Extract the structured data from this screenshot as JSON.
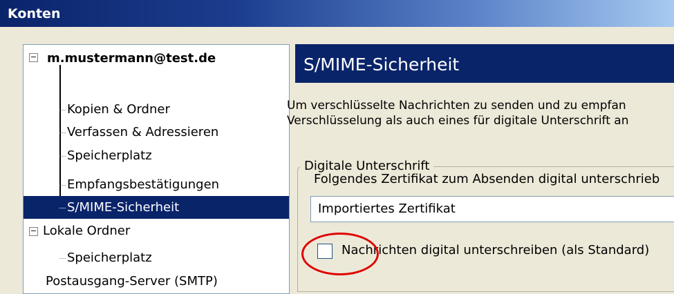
{
  "window": {
    "title": "Konten"
  },
  "tree": {
    "account": "m.mustermann@test.de",
    "account_children": [
      "Kopien & Ordner",
      "Verfassen & Adressieren",
      "Speicherplatz",
      "Empfangsbestätigungen",
      "S/MIME-Sicherheit"
    ],
    "local_folders": "Lokale Ordner",
    "local_children": [
      "Speicherplatz"
    ],
    "smtp": "Postausgang-Server (SMTP)",
    "expander_symbol": "⊟"
  },
  "panel": {
    "header": "S/MIME-Sicherheit",
    "desc_line1": "Um verschlüsselte Nachrichten zu senden und zu empfan",
    "desc_line2": "Verschlüsselung als auch eines für digitale Unterschrift an",
    "group_title": "Digitale Unterschrift",
    "cert_label": "Folgendes Zertifikat zum Absenden digital unterschrieb",
    "cert_value": "Importiertes Zertifikat",
    "sign_checkbox_label": "Nachrichten digital unterschreiben (als Standard)",
    "sign_checked": false
  },
  "colors": {
    "selection": "#0a246a",
    "highlight_circle": "#e00000"
  }
}
